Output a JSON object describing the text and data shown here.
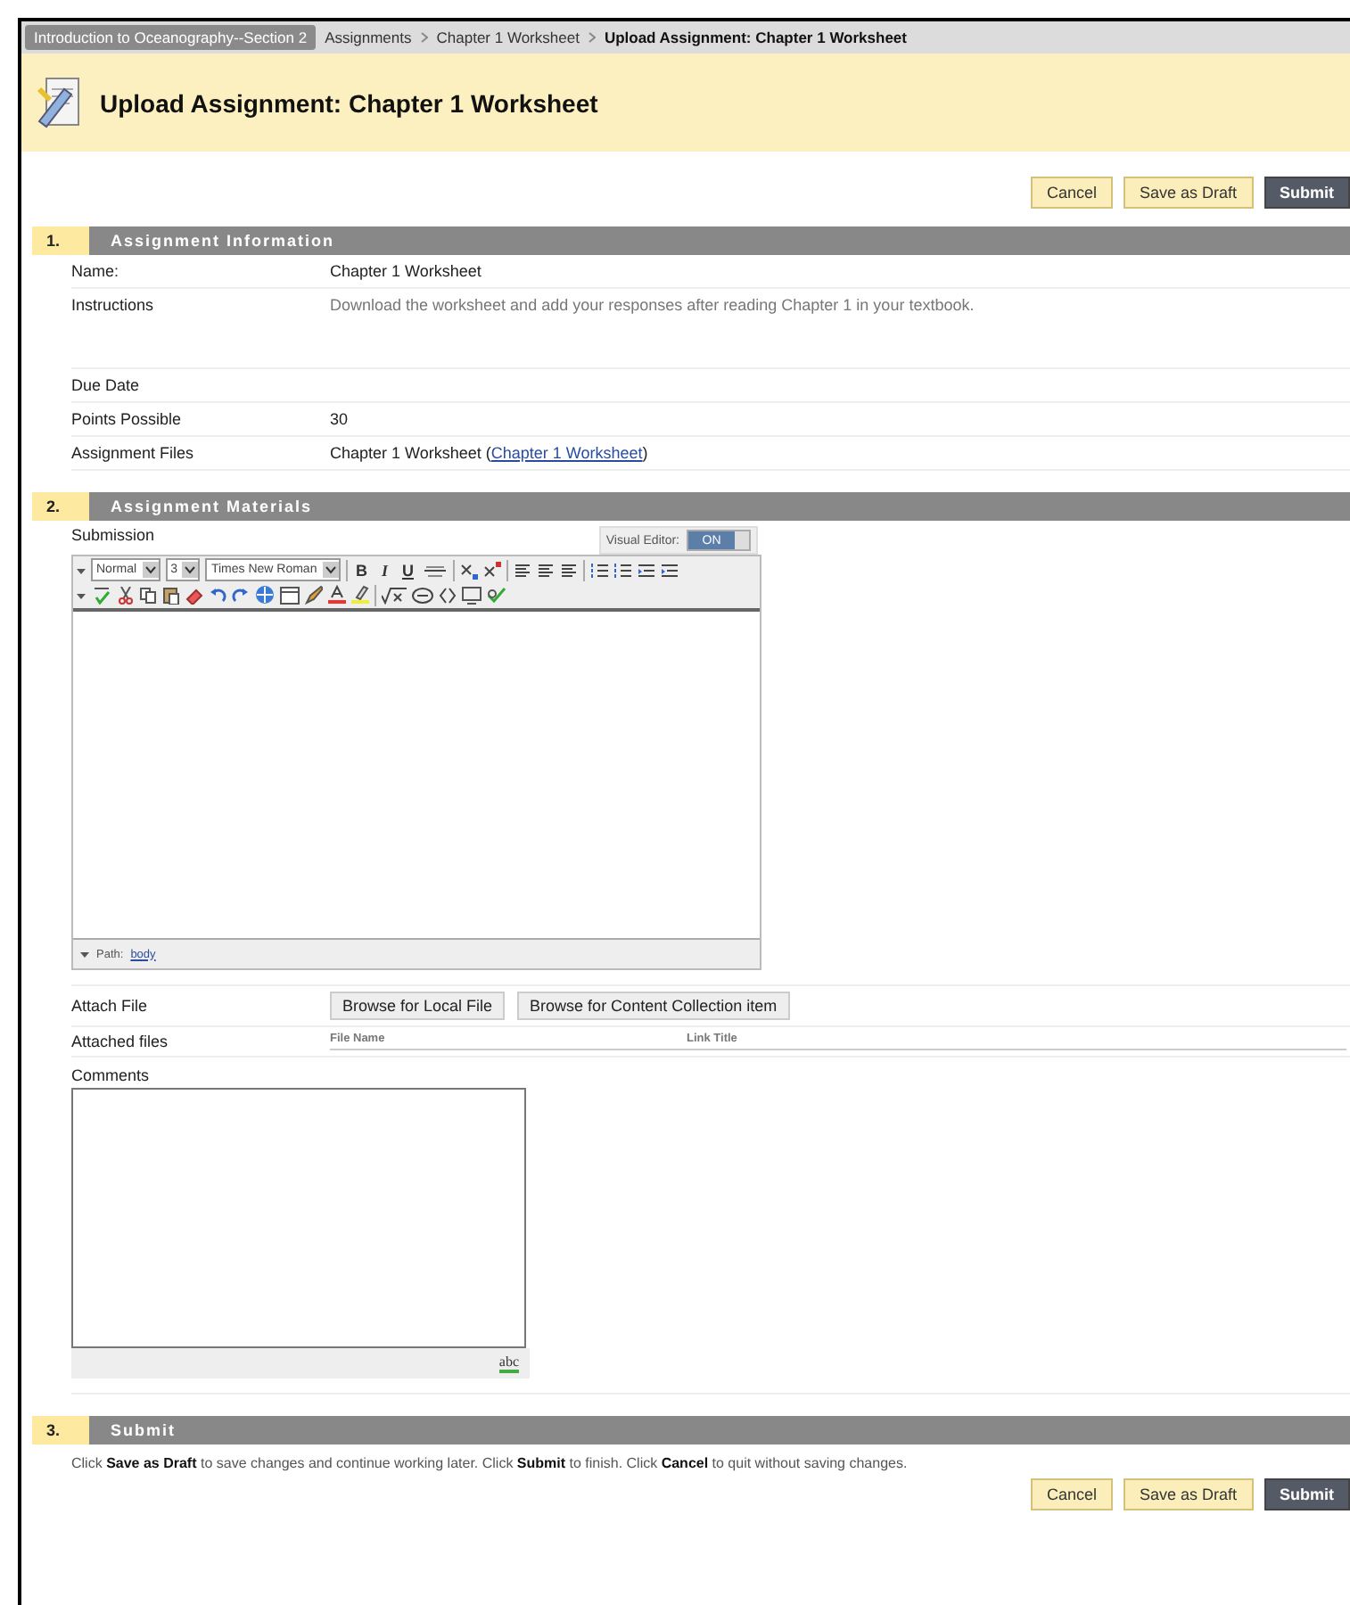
{
  "breadcrumb": {
    "course": "Introduction to Oceanography--Section 2",
    "items": [
      {
        "label": "Assignments",
        "current": false
      },
      {
        "label": "Chapter 1 Worksheet",
        "current": false
      },
      {
        "label": "Upload Assignment: Chapter 1 Worksheet",
        "current": true
      }
    ]
  },
  "page_title": "Upload Assignment: Chapter 1 Worksheet",
  "top_buttons": [
    {
      "label": "Cancel",
      "kind": "secondary"
    },
    {
      "label": "Save as Draft",
      "kind": "secondary"
    },
    {
      "label": "Submit",
      "kind": "primary"
    }
  ],
  "sections": [
    {
      "number": "1.",
      "title": "Assignment Information",
      "kind": "info",
      "rows": [
        {
          "label": "Name:",
          "value": "Chapter 1 Worksheet",
          "kind": "plain"
        },
        {
          "label": "Instructions",
          "value": "Download the worksheet and add your responses after reading Chapter 1 in your textbook.",
          "kind": "instructions"
        },
        {
          "label": "Due Date",
          "kind": "plain"
        },
        {
          "label": "Points Possible",
          "value": "30",
          "kind": "plain"
        },
        {
          "label": "Assignment Files",
          "value": "Chapter 1 Worksheet (",
          "link": "Chapter 1 Worksheet",
          "after": ")",
          "kind": "file"
        }
      ]
    },
    {
      "number": "2.",
      "title": "Assignment Materials",
      "kind": "materials",
      "submission": {
        "label": "Submission",
        "visual_editor": {
          "label": "Visual Editor:",
          "toggle": "ON",
          "on": true
        },
        "toolbar": [
          [
            {
              "kind": "caret"
            },
            {
              "kind": "select",
              "value": "Normal"
            },
            {
              "kind": "select",
              "value": "3"
            },
            {
              "kind": "select",
              "value": "Times New Roman"
            },
            {
              "kind": "sep"
            },
            {
              "kind": "bold",
              "label": "B"
            },
            {
              "kind": "italic",
              "label": "I"
            },
            {
              "kind": "underline",
              "label": "U"
            },
            {
              "kind": "strike"
            },
            {
              "kind": "sep"
            },
            {
              "kind": "sub"
            },
            {
              "kind": "sup"
            },
            {
              "kind": "sep"
            },
            {
              "kind": "align"
            },
            {
              "kind": "align"
            },
            {
              "kind": "align"
            },
            {
              "kind": "sep"
            },
            {
              "kind": "list"
            },
            {
              "kind": "list"
            },
            {
              "kind": "indent"
            },
            {
              "kind": "indent"
            }
          ],
          [
            {
              "kind": "caret"
            },
            {
              "kind": "spell"
            },
            {
              "kind": "cut"
            },
            {
              "kind": "copy"
            },
            {
              "kind": "paste"
            },
            {
              "kind": "eraser"
            },
            {
              "kind": "undo"
            },
            {
              "kind": "redo"
            },
            {
              "kind": "globe"
            },
            {
              "kind": "table"
            },
            {
              "kind": "pen"
            },
            {
              "kind": "fontcolor"
            },
            {
              "kind": "highlight"
            },
            {
              "kind": "sep"
            },
            {
              "kind": "math"
            },
            {
              "kind": "embed"
            },
            {
              "kind": "code"
            },
            {
              "kind": "preview"
            },
            {
              "kind": "links"
            }
          ]
        ],
        "path_label": "Path:",
        "path_link": "body"
      },
      "attach": {
        "label": "Attach File",
        "buttons": [
          "Browse for Local File",
          "Browse for Content Collection item"
        ]
      },
      "attached": {
        "label": "Attached files",
        "columns": [
          "File Name",
          "Link Title"
        ]
      },
      "comments": {
        "label": "Comments",
        "spell": "abc"
      }
    },
    {
      "number": "3.",
      "title": "Submit",
      "kind": "submit",
      "text": "Click **Save as Draft** to save changes and continue working later. Click **Submit** to finish. Click **Cancel** to quit without saving changes."
    }
  ],
  "bottom_buttons": [
    {
      "label": "Cancel",
      "kind": "secondary"
    },
    {
      "label": "Save as Draft",
      "kind": "secondary"
    },
    {
      "label": "Submit",
      "kind": "primary"
    }
  ]
}
